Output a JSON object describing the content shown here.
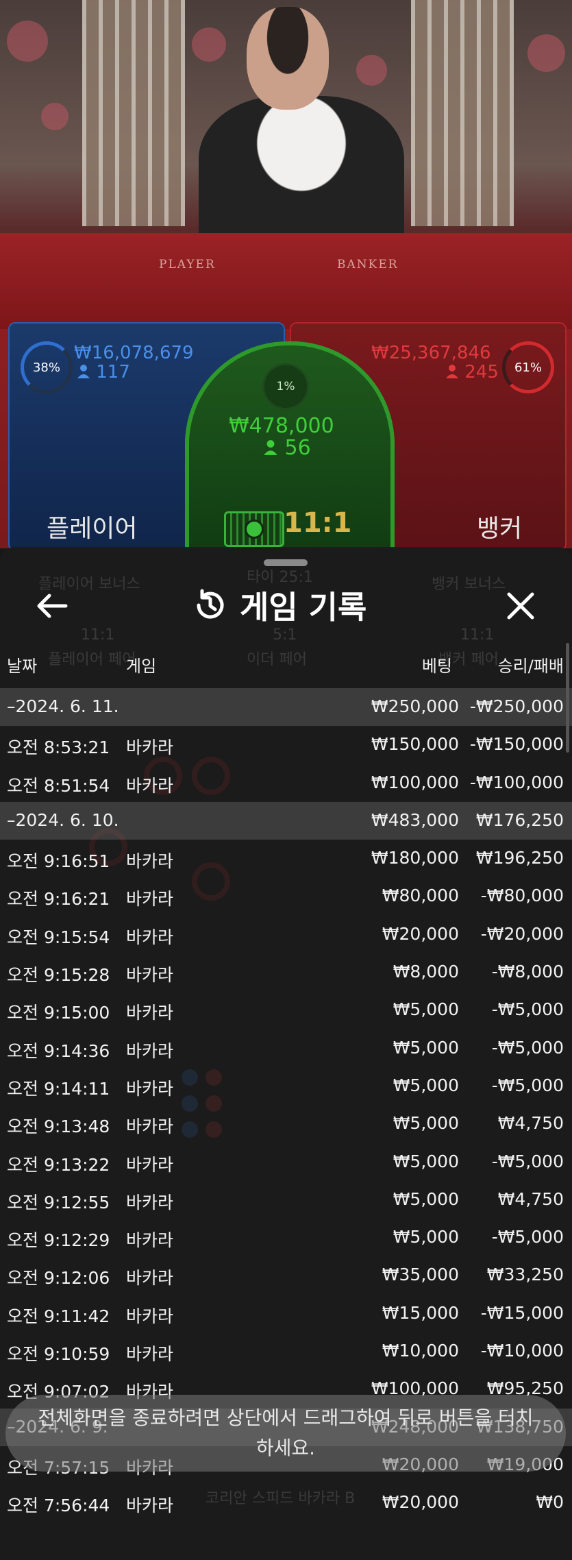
{
  "live": {
    "felt_player": "PLAYER",
    "felt_banker": "BANKER",
    "player": {
      "percent": "38%",
      "amount": "₩16,078,679",
      "count": "117",
      "label": "플레이어",
      "color": "#2e6fd0"
    },
    "tie": {
      "percent": "1%",
      "amount": "₩478,000",
      "count": "56",
      "payout": "11:1",
      "color": "#2e9a2c"
    },
    "banker": {
      "percent": "61%",
      "amount": "₩25,367,846",
      "count": "245",
      "label": "뱅커",
      "color": "#d22a2e"
    }
  },
  "sheet": {
    "title": "게임 기록",
    "icons": {
      "back": "arrow-left-icon",
      "history": "history-icon",
      "close": "close-icon",
      "user": "user-icon"
    },
    "columns": {
      "date": "날짜",
      "game": "게임",
      "bet": "베팅",
      "result": "승리/패배"
    },
    "rows": [
      {
        "type": "date",
        "time": "–2024. 6. 11.",
        "game": "",
        "bet": "₩250,000",
        "result": "-₩250,000"
      },
      {
        "type": "entry",
        "time": "오전 8:53:21",
        "game": "바카라",
        "bet": "₩150,000",
        "result": "-₩150,000"
      },
      {
        "type": "entry",
        "time": "오전 8:51:54",
        "game": "바카라",
        "bet": "₩100,000",
        "result": "-₩100,000"
      },
      {
        "type": "date",
        "time": "–2024. 6. 10.",
        "game": "",
        "bet": "₩483,000",
        "result": "₩176,250"
      },
      {
        "type": "entry",
        "time": "오전 9:16:51",
        "game": "바카라",
        "bet": "₩180,000",
        "result": "₩196,250"
      },
      {
        "type": "entry",
        "time": "오전 9:16:21",
        "game": "바카라",
        "bet": "₩80,000",
        "result": "-₩80,000"
      },
      {
        "type": "entry",
        "time": "오전 9:15:54",
        "game": "바카라",
        "bet": "₩20,000",
        "result": "-₩20,000"
      },
      {
        "type": "entry",
        "time": "오전 9:15:28",
        "game": "바카라",
        "bet": "₩8,000",
        "result": "-₩8,000"
      },
      {
        "type": "entry",
        "time": "오전 9:15:00",
        "game": "바카라",
        "bet": "₩5,000",
        "result": "-₩5,000"
      },
      {
        "type": "entry",
        "time": "오전 9:14:36",
        "game": "바카라",
        "bet": "₩5,000",
        "result": "-₩5,000"
      },
      {
        "type": "entry",
        "time": "오전 9:14:11",
        "game": "바카라",
        "bet": "₩5,000",
        "result": "-₩5,000"
      },
      {
        "type": "entry",
        "time": "오전 9:13:48",
        "game": "바카라",
        "bet": "₩5,000",
        "result": "₩4,750"
      },
      {
        "type": "entry",
        "time": "오전 9:13:22",
        "game": "바카라",
        "bet": "₩5,000",
        "result": "-₩5,000"
      },
      {
        "type": "entry",
        "time": "오전 9:12:55",
        "game": "바카라",
        "bet": "₩5,000",
        "result": "₩4,750"
      },
      {
        "type": "entry",
        "time": "오전 9:12:29",
        "game": "바카라",
        "bet": "₩5,000",
        "result": "-₩5,000"
      },
      {
        "type": "entry",
        "time": "오전 9:12:06",
        "game": "바카라",
        "bet": "₩35,000",
        "result": "₩33,250"
      },
      {
        "type": "entry",
        "time": "오전 9:11:42",
        "game": "바카라",
        "bet": "₩15,000",
        "result": "-₩15,000"
      },
      {
        "type": "entry",
        "time": "오전 9:10:59",
        "game": "바카라",
        "bet": "₩10,000",
        "result": "-₩10,000"
      },
      {
        "type": "entry",
        "time": "오전 9:07:02",
        "game": "바카라",
        "bet": "₩100,000",
        "result": "₩95,250"
      },
      {
        "type": "date",
        "time": "–2024. 6. 9.",
        "game": "",
        "bet": "₩248,000",
        "result": "₩138,750"
      },
      {
        "type": "entry",
        "time": "오전 7:57:15",
        "game": "바카라",
        "bet": "₩20,000",
        "result": "₩19,000"
      },
      {
        "type": "entry",
        "time": "오전 7:56:44",
        "game": "바카라",
        "bet": "₩20,000",
        "result": "₩0"
      }
    ],
    "ghost_background": {
      "player_bonus": "플레이어 보너스",
      "tie_bonus": "타이 25:1",
      "banker_bonus": "뱅커 보너스",
      "p_pair_odds": "11:1",
      "p_pair": "플레이어 페어",
      "either_odds": "5:1",
      "either_pair": "이더 페어",
      "b_pair_odds": "11:1",
      "b_pair": "뱅커 페어",
      "promo": "코리안 스피드 바카라 B"
    }
  },
  "toast": {
    "text": "전체화면을 종료하려면 상단에서 드래그하여 뒤로 버튼을 터치하세요."
  }
}
